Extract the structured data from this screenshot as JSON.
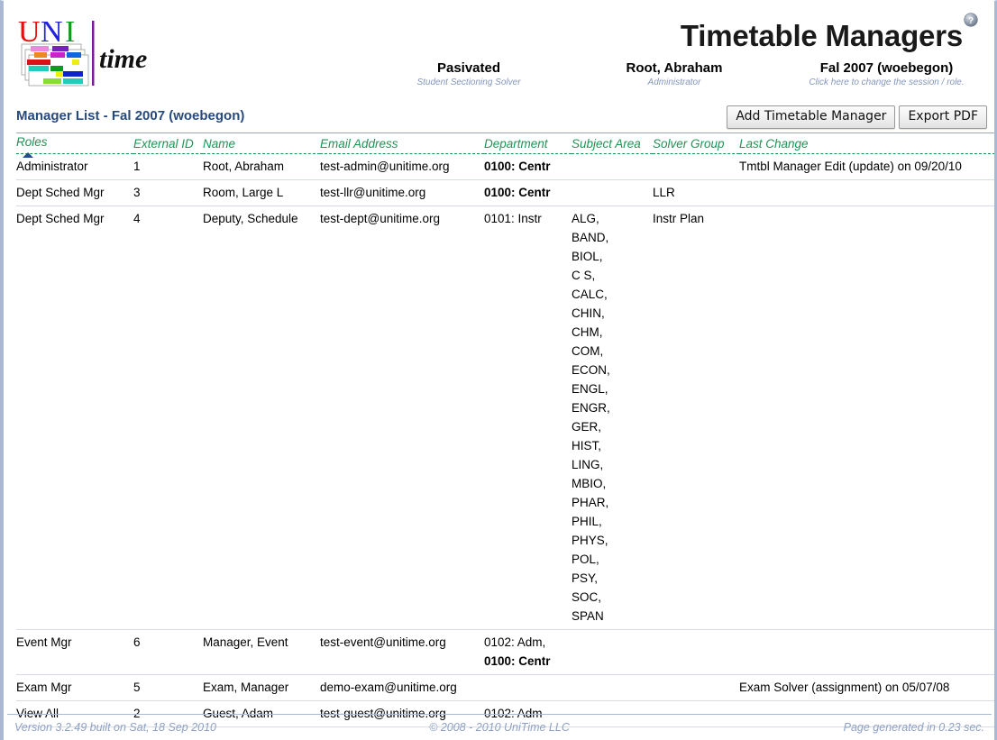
{
  "app": {
    "title": "Timetable Managers",
    "help_icon": "help-question-icon"
  },
  "logo": {
    "uni_text": "UNI",
    "time_text": "time"
  },
  "session_bar": [
    {
      "main": "Pasivated",
      "sub": "Student Sectioning Solver"
    },
    {
      "main": "Root, Abraham",
      "sub": "Administrator"
    },
    {
      "main": "Fal 2007 (woebegon)",
      "sub": "Click here to change the session / role."
    }
  ],
  "page_title": "Manager List - Fal 2007 (woebegon)",
  "buttons": {
    "add_manager": "Add Timetable Manager",
    "export_pdf": "Export PDF"
  },
  "table": {
    "sorted_column": "Roles",
    "sort_direction": "asc",
    "headers": [
      "Roles",
      "External ID",
      "Name",
      "Email Address",
      "Department",
      "Subject Area",
      "Solver Group",
      "Last Change"
    ],
    "rows": [
      {
        "roles": "Administrator",
        "external_id": "1",
        "name": "Root, Abraham",
        "email": "test-admin@unitime.org",
        "departments": [
          {
            "text": "0100: Centr",
            "bold": true
          }
        ],
        "subjects": [],
        "solver_group": "",
        "last_change": "Tmtbl Manager Edit (update) on 09/20/10"
      },
      {
        "roles": "Dept Sched Mgr",
        "external_id": "3",
        "name": "Room, Large L",
        "email": "test-llr@unitime.org",
        "departments": [
          {
            "text": "0100: Centr",
            "bold": true
          }
        ],
        "subjects": [],
        "solver_group": "LLR",
        "last_change": ""
      },
      {
        "roles": "Dept Sched Mgr",
        "external_id": "4",
        "name": "Deputy, Schedule",
        "email": "test-dept@unitime.org",
        "departments": [
          {
            "text": "0101: Instr",
            "bold": false
          }
        ],
        "subjects": [
          "ALG,",
          "BAND,",
          "BIOL,",
          "C S,",
          "CALC,",
          "CHIN,",
          "CHM,",
          "COM,",
          "ECON,",
          "ENGL,",
          "ENGR,",
          "GER,",
          "HIST,",
          "LING,",
          "MBIO,",
          "PHAR,",
          "PHIL,",
          "PHYS,",
          "POL,",
          "PSY,",
          "SOC,",
          "SPAN"
        ],
        "solver_group": "Instr Plan",
        "last_change": ""
      },
      {
        "roles": "Event Mgr",
        "external_id": "6",
        "name": "Manager, Event",
        "email": "test-event@unitime.org",
        "departments": [
          {
            "text": "0102: Adm,",
            "bold": false
          },
          {
            "text": "0100: Centr",
            "bold": true
          }
        ],
        "subjects": [],
        "solver_group": "",
        "last_change": ""
      },
      {
        "roles": "Exam Mgr",
        "external_id": "5",
        "name": "Exam, Manager",
        "email": "demo-exam@unitime.org",
        "departments": [],
        "subjects": [],
        "solver_group": "",
        "last_change": "Exam Solver (assignment) on 05/07/08"
      },
      {
        "roles": "View All",
        "external_id": "2",
        "name": "Guest, Adam",
        "email": "test-guest@unitime.org",
        "departments": [
          {
            "text": "0102: Adm",
            "bold": false
          }
        ],
        "subjects": [],
        "solver_group": "",
        "last_change": ""
      }
    ]
  },
  "footer": {
    "version": "Version 3.2.49 built on Sat, 18 Sep 2010",
    "copyright": "© 2008 - 2010 UniTime LLC",
    "generated": "Page generated in 0.23 sec."
  },
  "colors": {
    "header_green": "#1e9455",
    "title_navy": "#274a7e",
    "link_blue": "#2b3fa0",
    "footer_blue": "#8ea0c4",
    "border_blue": "#aab8d4"
  }
}
